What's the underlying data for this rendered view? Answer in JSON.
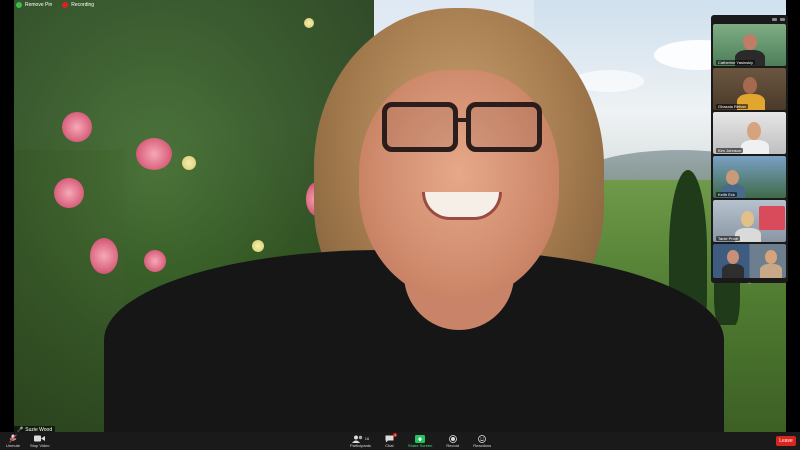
{
  "status": {
    "remove_pin_label": "Remove Pin",
    "recording_label": "Recording",
    "recording_color": "#e02020"
  },
  "main_speaker": {
    "name": "Suzie Wood"
  },
  "participants": [
    {
      "name": "Catherine Yasinskiy"
    },
    {
      "name": "Ghazala Rehan"
    },
    {
      "name": "Kim Johnson"
    },
    {
      "name": "Keith Eck"
    },
    {
      "name": "Tanie Price"
    },
    {
      "name": ""
    }
  ],
  "participants_count": "16",
  "toolbar": {
    "unmute_label": "Unmute",
    "stop_video_label": "Stop Video",
    "participants_label": "Participants",
    "chat_label": "Chat",
    "share_screen_label": "Share Screen",
    "record_label": "Record",
    "reactions_label": "Reactions",
    "leave_label": "Leave",
    "chat_badge": "1",
    "share_color": "#22c55e",
    "leave_color": "#d9251d"
  },
  "icons": {
    "mic": "mic-muted-icon",
    "video": "video-camera-icon",
    "participants": "people-icon",
    "chat": "chat-bubble-icon",
    "share": "share-screen-icon",
    "record": "record-icon",
    "reactions": "smile-icon"
  }
}
